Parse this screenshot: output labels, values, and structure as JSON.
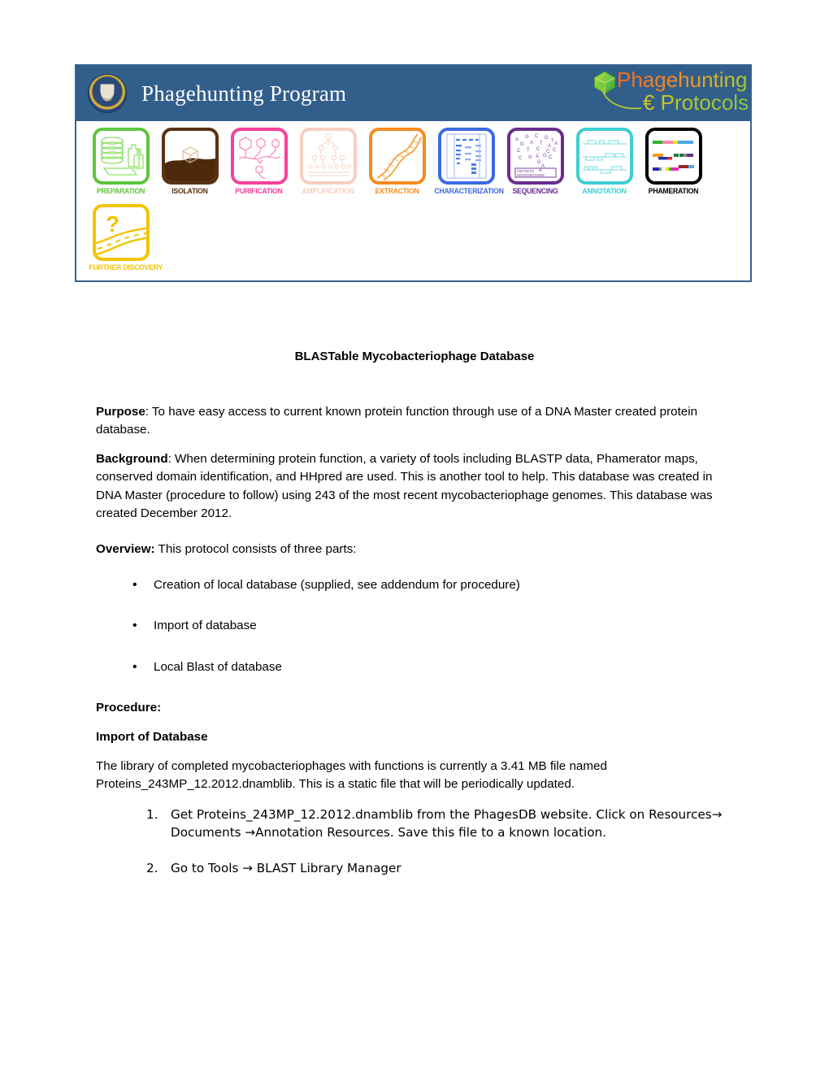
{
  "banner": {
    "seal_alt": "university-of-pittsburgh-seal",
    "title": "Phagehunting Program",
    "logo_line1": "Phagehunting",
    "logo_line2": "€ Protocols",
    "colors": {
      "banner_blue": "#325e8c",
      "banner_border": "#3a628f"
    },
    "stages": [
      {
        "label": "PREPARATION",
        "color": "#5ec63c",
        "icon": "petri-dish-stack-icon"
      },
      {
        "label": "ISOLATION",
        "color": "#5a3210",
        "icon": "soil-phage-icon"
      },
      {
        "label": "PURIFICATION",
        "color": "#f5419a",
        "icon": "phage-particles-icon"
      },
      {
        "label": "AMPLIFICATION",
        "color": "#f7cfc0",
        "icon": "phage-multiplication-icon"
      },
      {
        "label": "EXTRACTION",
        "color": "#f68b1f",
        "icon": "dna-helix-icon"
      },
      {
        "label": "CHARACTERIZATION",
        "color": "#3c6ae1",
        "icon": "gel-electrophoresis-icon"
      },
      {
        "label": "SEQUENCING",
        "color": "#6b2d8f",
        "icon": "dna-bases-icon"
      },
      {
        "label": "ANNOTATION",
        "color": "#3ecfd5",
        "icon": "genome-tracks-icon"
      },
      {
        "label": "PHAMERATION",
        "color": "#000000",
        "icon": "phamerator-map-icon"
      },
      {
        "label": "FURTHER DISCOVERY",
        "color": "#f2c400",
        "icon": "question-road-icon"
      }
    ]
  },
  "document": {
    "title": "BLASTable Mycobacteriophage Database",
    "purpose_label": "Purpose",
    "purpose_text": ": To have easy access to current known protein function through use of a DNA Master created protein database.",
    "background_label": "Background",
    "background_text": ": When determining protein function, a variety of tools including BLASTP data, Phamerator maps, conserved domain identification, and HHpred are used. This is another tool to help. This database was created in DNA Master (procedure to follow) using 243 of the most recent mycobacteriophage genomes. This database was created December 2012.",
    "overview_label": "Overview:",
    "overview_text": "  This protocol consists of three parts:",
    "overview_bullets": [
      "Creation of local database (supplied, see addendum for procedure)",
      "Import of database",
      "Local Blast of database"
    ],
    "procedure_heading": "Procedure:",
    "import_heading": "Import of Database",
    "library_text": "The library of completed mycobacteriophages with functions is currently a 3.41 MB file named Proteins_243MP_12.2012.dnamblib. This is a static file that will be periodically updated.",
    "steps": [
      "Get Proteins_243MP_12.2012.dnamblib from the PhagesDB website. Click on Resources→ Documents →Annotation Resources. Save this file to a known location.",
      "Go to Tools → BLAST Library Manager"
    ]
  }
}
